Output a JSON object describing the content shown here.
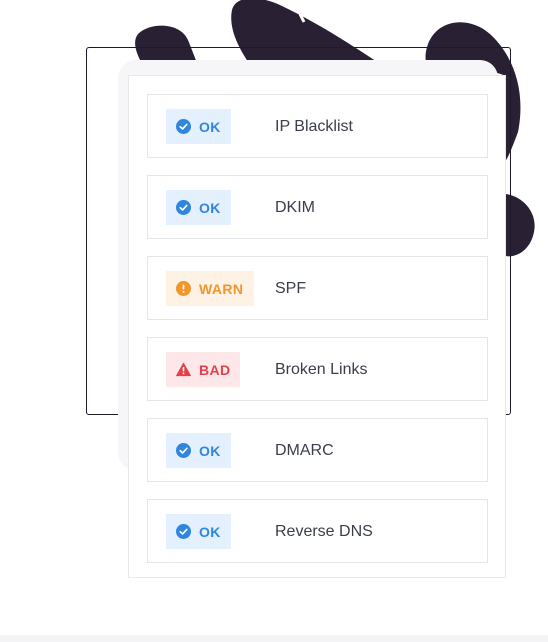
{
  "colors": {
    "ok": "#2f86e0",
    "ok_bg": "#e4f0fd",
    "warn": "#f0962b",
    "warn_bg": "#fdf2e3",
    "bad": "#e0414d",
    "bad_bg": "#fde7e9",
    "text": "#3a3d4c",
    "decor": "#2a2033"
  },
  "checks": [
    {
      "status": "OK",
      "icon": "check-circle-icon",
      "label": "IP Blacklist"
    },
    {
      "status": "OK",
      "icon": "check-circle-icon",
      "label": "DKIM"
    },
    {
      "status": "WARN",
      "icon": "exclamation-circle-icon",
      "label": "SPF"
    },
    {
      "status": "BAD",
      "icon": "warning-triangle-icon",
      "label": "Broken Links"
    },
    {
      "status": "OK",
      "icon": "check-circle-icon",
      "label": "DMARC"
    },
    {
      "status": "OK",
      "icon": "check-circle-icon",
      "label": "Reverse DNS"
    }
  ]
}
